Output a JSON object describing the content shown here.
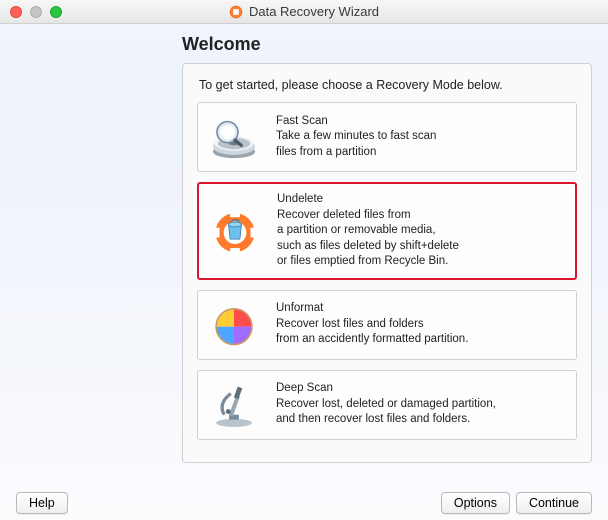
{
  "title": "Data Recovery Wizard",
  "welcome": "Welcome",
  "panel": {
    "intro": "To get started, please choose a Recovery Mode below.",
    "modes": {
      "fastscan": {
        "title": "Fast Scan",
        "desc": "Take a few minutes to fast scan\nfiles from a partition"
      },
      "undelete": {
        "title": "Undelete",
        "desc": "Recover deleted files from\na partition or removable media,\nsuch as files deleted by shift+delete\nor files emptied from Recycle Bin."
      },
      "unformat": {
        "title": "Unformat",
        "desc": "Recover lost files and folders\nfrom an accidently formatted partition."
      },
      "deepscan": {
        "title": "Deep Scan",
        "desc": "Recover lost, deleted or damaged partition,\nand then recover lost files and folders."
      }
    }
  },
  "buttons": {
    "help": "Help",
    "options": "Options",
    "continue": "Continue"
  }
}
